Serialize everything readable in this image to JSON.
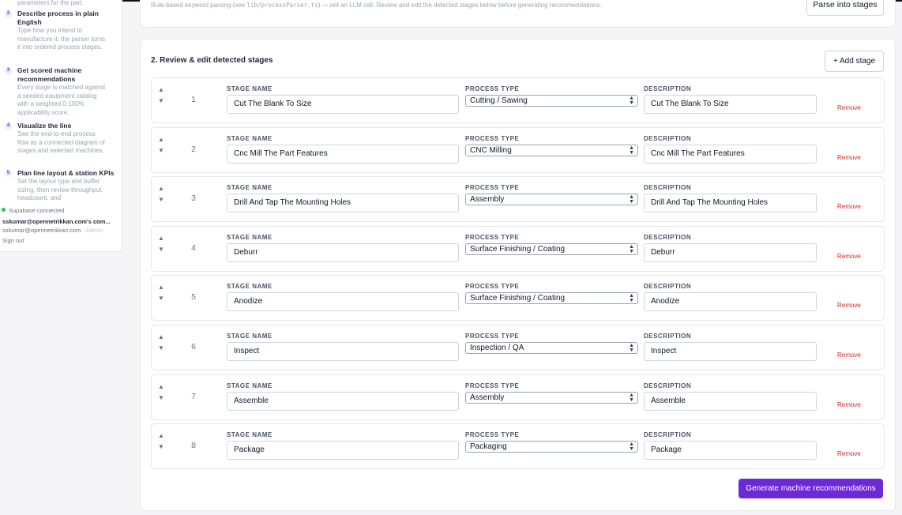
{
  "sidebar": {
    "fragment": "parameters for the part.",
    "steps": [
      {
        "num": "2",
        "title": "Describe process in plain English",
        "desc": "Type how you intend to manufacture it; the parser turns it into ordered process stages."
      },
      {
        "num": "3",
        "title": "Get scored machine recommendations",
        "desc": "Every stage is matched against a seeded equipment catalog with a weighted 0-100% applicability score."
      },
      {
        "num": "4",
        "title": "Visualize the line",
        "desc": "See the end-to-end process flow as a connected diagram of stages and selected machines."
      },
      {
        "num": "5",
        "title": "Plan line layout & station KPIs",
        "desc": "Set the layout type and buffer sizing, then review throughput, headcount, and"
      }
    ],
    "status": "Supabase connected",
    "user_name": "sskumar@opennetrikkan.com's com...",
    "user_email": "sskumar@opennetrikkan.com",
    "separator": "·",
    "user_role": "Admin",
    "sign_out": "Sign out"
  },
  "parse_card": {
    "note_before": "Rule-based keyword parsing (see ",
    "note_code": "lib/processParser.ts",
    "note_after": ") — not an LLM call. Review and edit the detected stages below before generating recommendations.",
    "parse_button": "Parse into stages"
  },
  "review": {
    "title": "2. Review & edit detected stages",
    "add_button": "+ Add stage",
    "labels": {
      "name": "STAGE NAME",
      "type": "PROCESS TYPE",
      "desc": "DESCRIPTION"
    },
    "remove_label": "Remove",
    "up_arrow": "▲",
    "down_arrow": "▼",
    "stages": [
      {
        "index": "1",
        "name": "Cut The Blank To Size",
        "type": "Cutting / Sawing",
        "desc": "Cut The Blank To Size"
      },
      {
        "index": "2",
        "name": "Cnc Mill The Part Features",
        "type": "CNC Milling",
        "desc": "Cnc Mill The Part Features"
      },
      {
        "index": "3",
        "name": "Drill And Tap The Mounting Holes",
        "type": "Assembly",
        "desc": "Drill And Tap The Mounting Holes"
      },
      {
        "index": "4",
        "name": "Deburr",
        "type": "Surface Finishing / Coating",
        "desc": "Deburr"
      },
      {
        "index": "5",
        "name": "Anodize",
        "type": "Surface Finishing / Coating",
        "desc": "Anodize"
      },
      {
        "index": "6",
        "name": "Inspect",
        "type": "Inspection / QA",
        "desc": "Inspect"
      },
      {
        "index": "7",
        "name": "Assemble",
        "type": "Assembly",
        "desc": "Assemble"
      },
      {
        "index": "8",
        "name": "Package",
        "type": "Packaging",
        "desc": "Package"
      }
    ],
    "generate_button": "Generate machine recommendations"
  },
  "colors": {
    "accent": "#6d28d9",
    "remove": "#dc2626",
    "status_ok": "#22c55e"
  }
}
